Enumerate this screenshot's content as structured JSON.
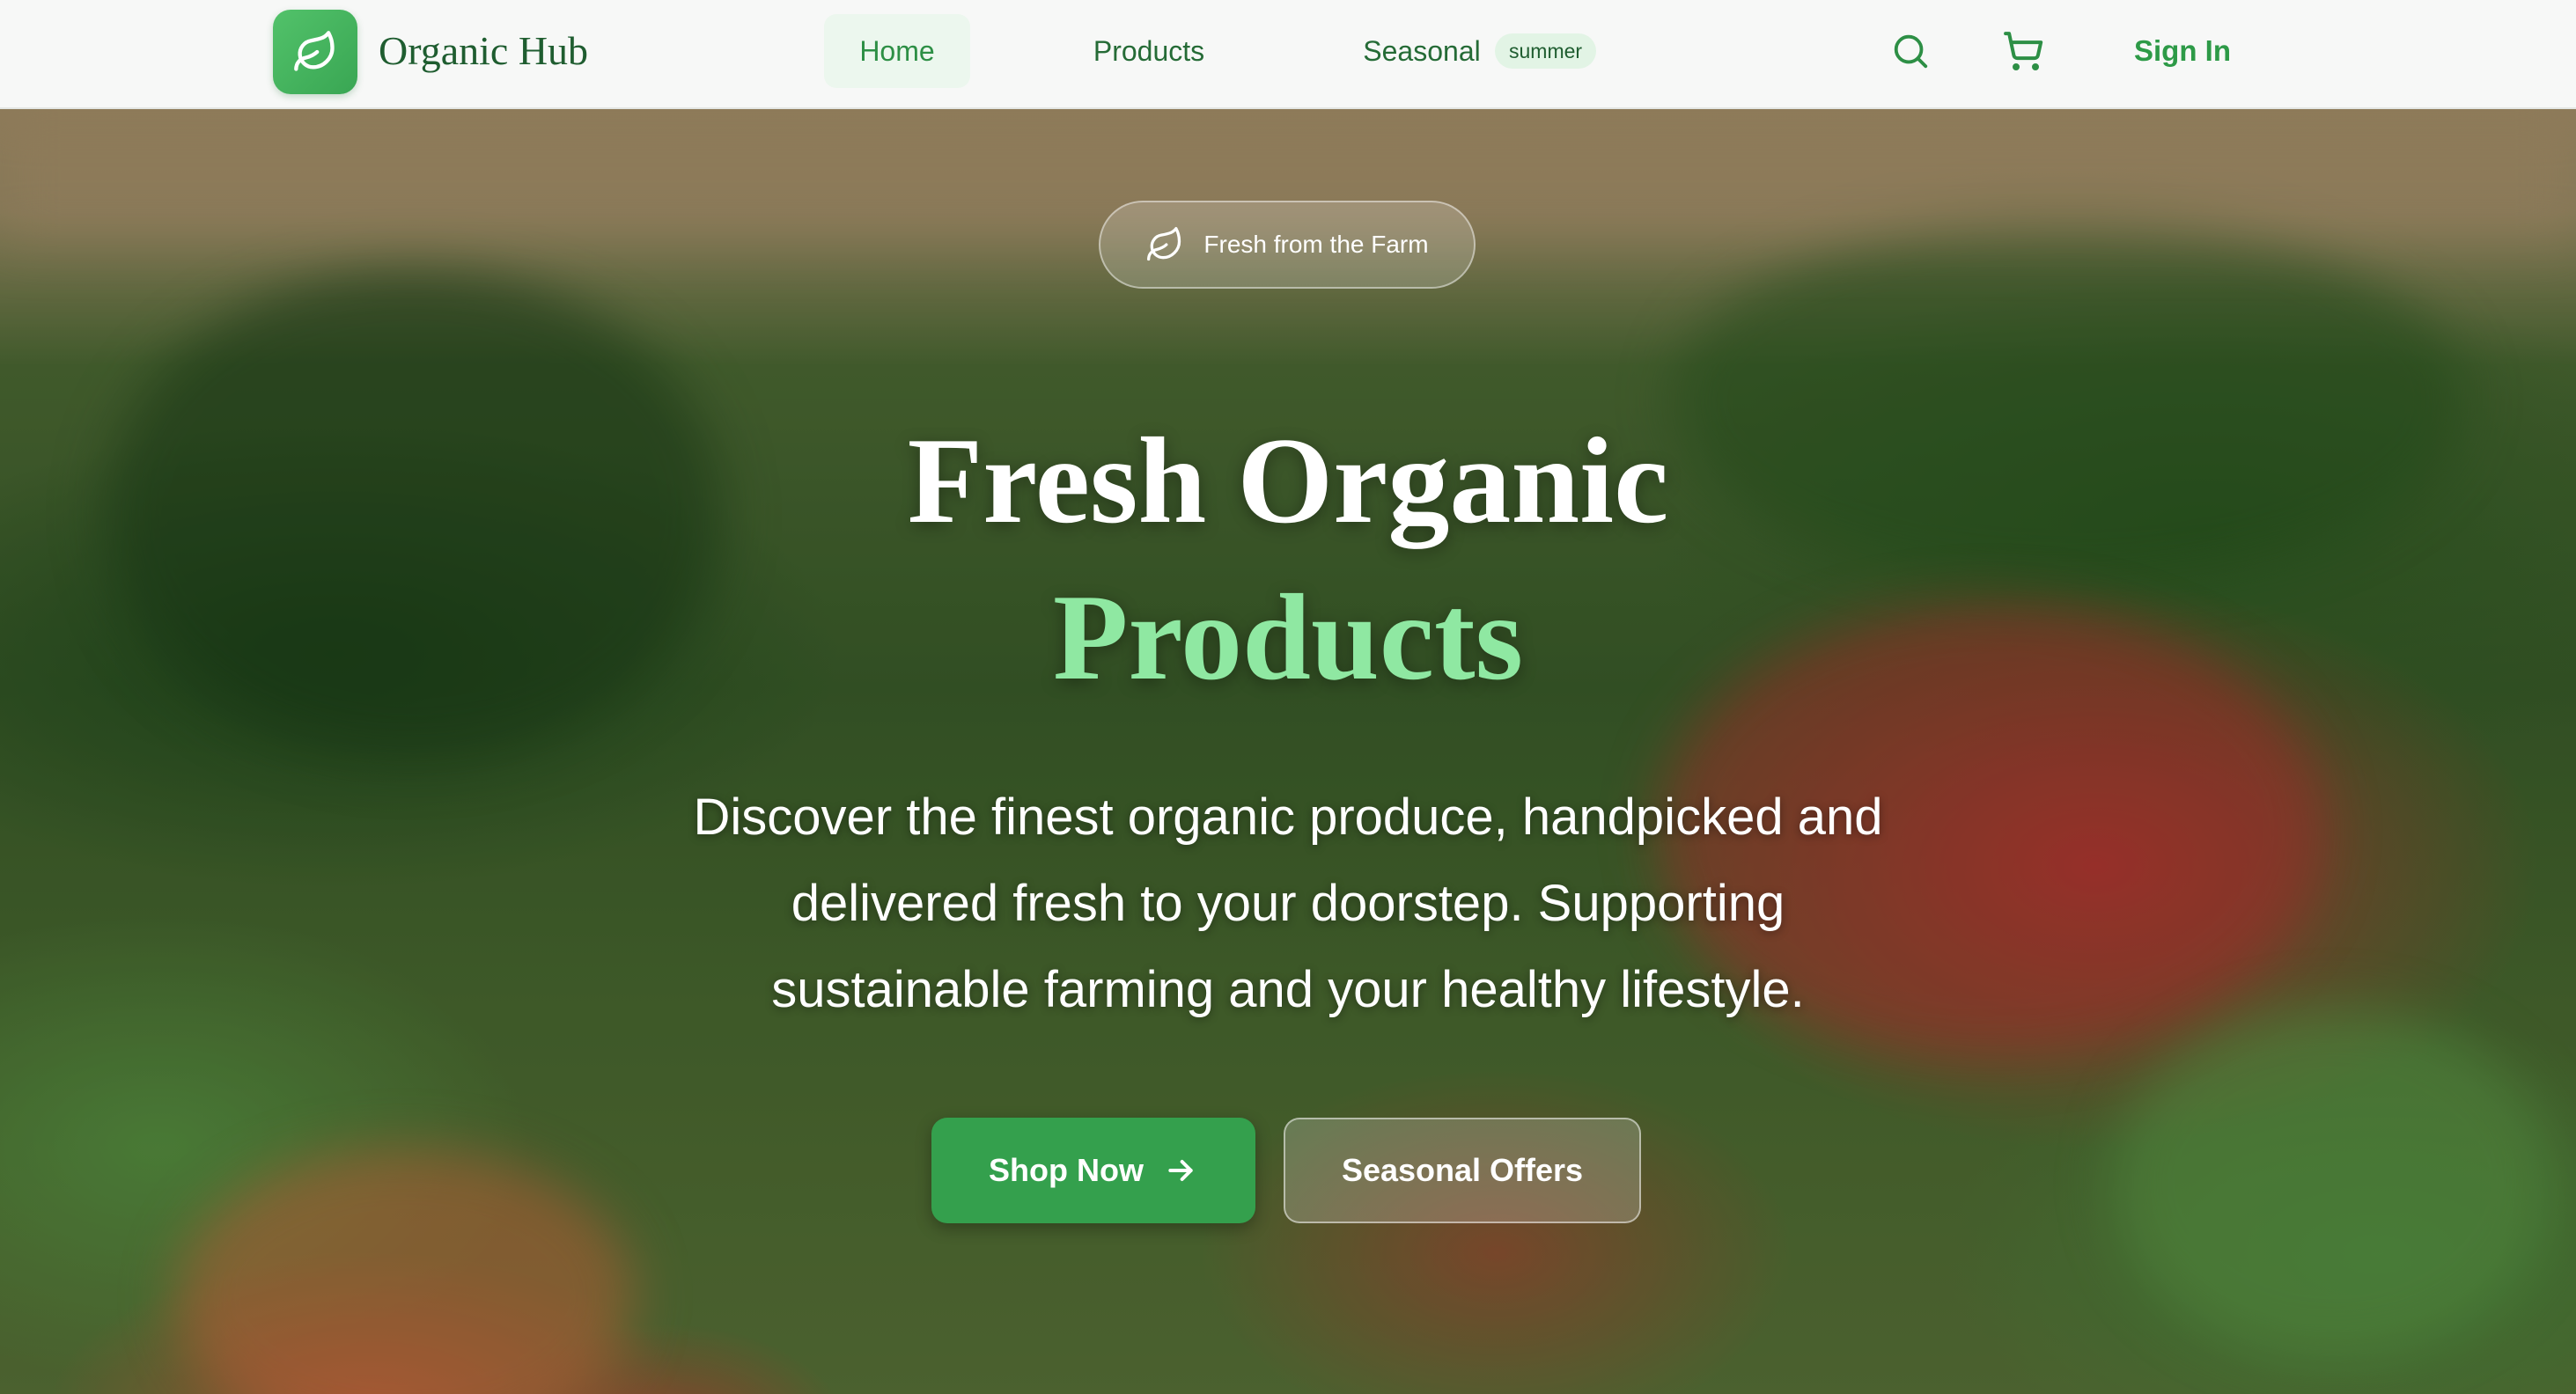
{
  "brand": {
    "name": "Organic Hub",
    "logo_icon": "leaf-icon",
    "accent": "#39a653"
  },
  "nav": {
    "links": [
      {
        "label": "Home",
        "active": true
      },
      {
        "label": "Products",
        "active": false
      },
      {
        "label": "Seasonal",
        "active": false
      }
    ],
    "season_badge": "summer",
    "search_icon": "search-icon",
    "cart_icon": "cart-icon",
    "sign_in": "Sign In"
  },
  "hero": {
    "tag": "Fresh from the Farm",
    "tag_icon": "leaf-icon",
    "headline_line1": "Fresh Organic",
    "headline_line2": "Products",
    "headline_accent": "#8fe8a2",
    "subtitle_lines": [
      "Discover the finest organic produce, handpicked and",
      "delivered fresh to your doorstep. Supporting",
      "sustainable farming and your healthy lifestyle."
    ],
    "primary_cta": "Shop Now",
    "primary_cta_icon": "arrow-right-icon",
    "secondary_cta": "Seasonal Offers"
  }
}
